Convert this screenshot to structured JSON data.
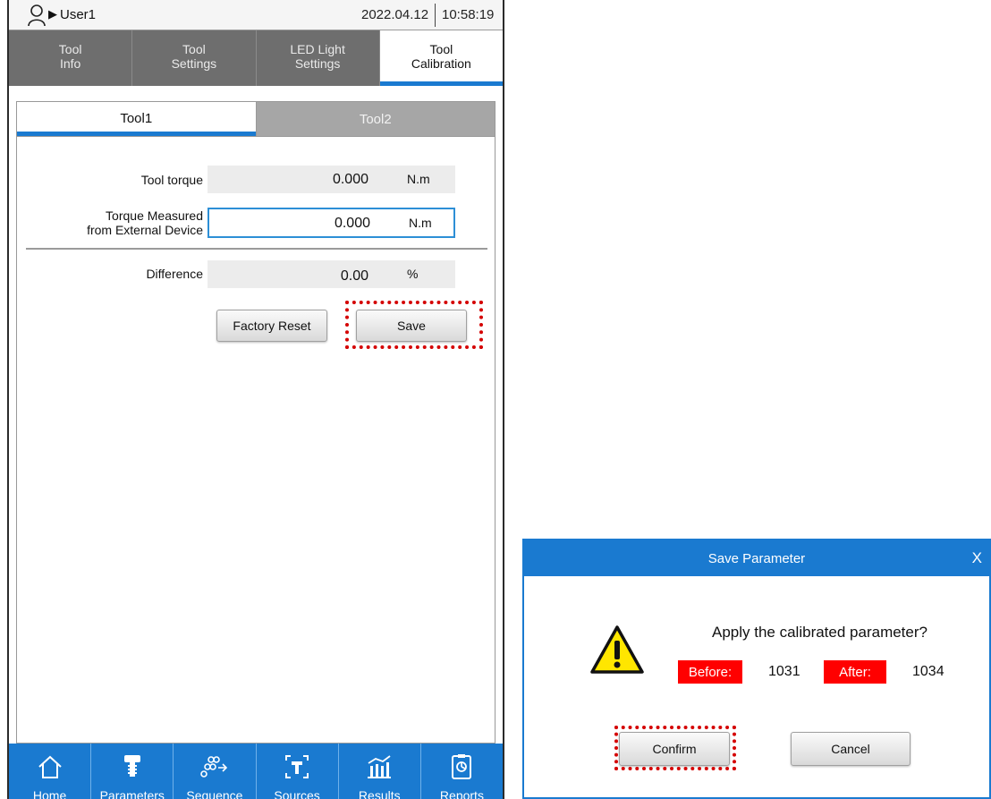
{
  "status_bar": {
    "user": "User1",
    "date": "2022.04.12",
    "time": "10:58:19"
  },
  "tabs": [
    {
      "label": "Tool\nInfo",
      "active": false
    },
    {
      "label": "Tool\nSettings",
      "active": false
    },
    {
      "label": "LED Light\nSettings",
      "active": false
    },
    {
      "label": "Tool\nCalibration",
      "active": true
    }
  ],
  "tool_tabs": [
    {
      "label": "Tool1",
      "active": true
    },
    {
      "label": "Tool2",
      "active": false
    }
  ],
  "calibration": {
    "tool_torque": {
      "label": "Tool torque",
      "value": "0.000",
      "unit": "N.m"
    },
    "external_torque": {
      "label": "Torque Measured\nfrom External Device",
      "value": "0.000",
      "unit": "N.m"
    },
    "difference": {
      "label": "Difference",
      "value": "0.00",
      "unit": "%"
    },
    "factory_reset_label": "Factory Reset",
    "save_label": "Save"
  },
  "bottom_nav": [
    {
      "label": "Home",
      "icon": "home-icon"
    },
    {
      "label": "Parameters",
      "icon": "screw-icon"
    },
    {
      "label": "Sequence",
      "icon": "sequence-icon"
    },
    {
      "label": "Sources",
      "icon": "sources-icon"
    },
    {
      "label": "Results",
      "icon": "results-icon"
    },
    {
      "label": "Reports",
      "icon": "reports-icon"
    }
  ],
  "dialog": {
    "title": "Save Parameter",
    "close": "X",
    "message": "Apply the calibrated parameter?",
    "before_label": "Before:",
    "before_value": "1031",
    "after_label": "After:",
    "after_value": "1034",
    "confirm_label": "Confirm",
    "cancel_label": "Cancel"
  },
  "colors": {
    "accent": "#1a7ad0",
    "tab_bg": "#6e6e6e",
    "highlight": "#d40000",
    "tag_red": "#ff0000"
  }
}
